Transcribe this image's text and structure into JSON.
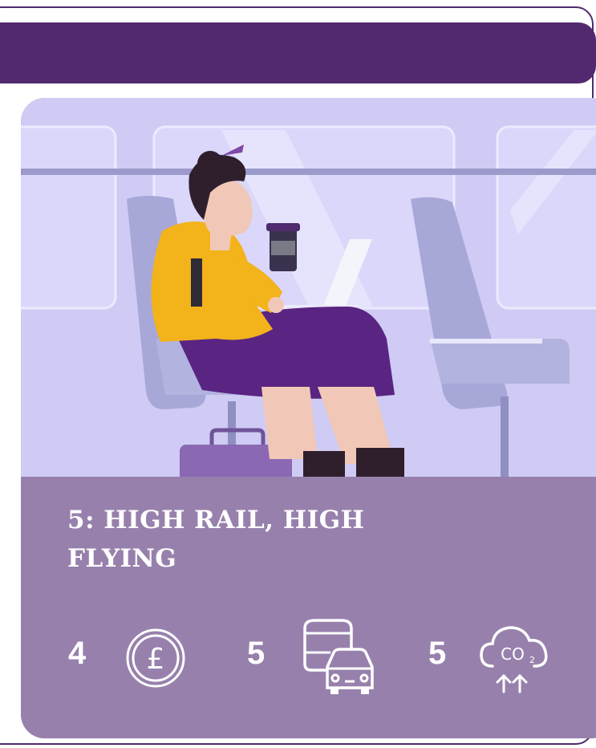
{
  "colors": {
    "header": "#52286f",
    "panel": "#9781ac",
    "text": "#ffffff",
    "scene_background": "#cfcbf4",
    "seat": "#a7a7d8",
    "sweater": "#f2b31b",
    "skirt": "#5a2483"
  },
  "scenario": {
    "title": "5: HIGH RAIL, HIGH FLYING"
  },
  "metrics": [
    {
      "value": "4",
      "icon": "pound-coin-icon"
    },
    {
      "value": "5",
      "icon": "bus-car-icon"
    },
    {
      "value": "5",
      "icon": "co2-cloud-icon"
    }
  ]
}
